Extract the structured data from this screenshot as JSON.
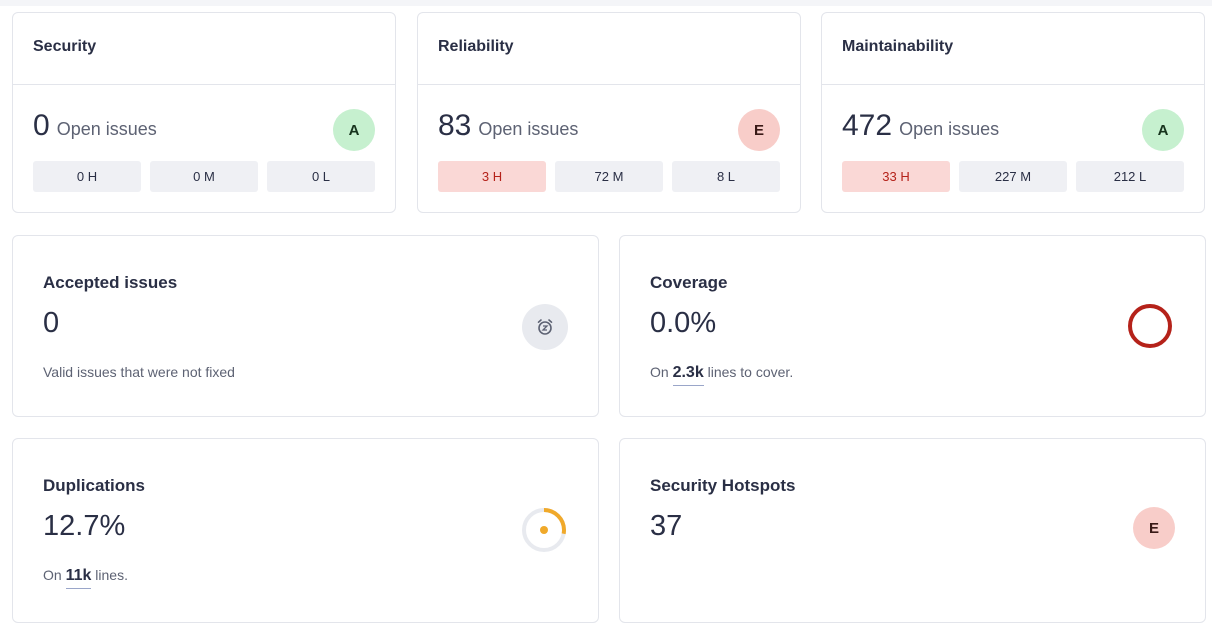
{
  "security": {
    "title": "Security",
    "count": "0",
    "open_label": "Open issues",
    "rating": "A",
    "severities": [
      "0 H",
      "0 M",
      "0 L"
    ]
  },
  "reliability": {
    "title": "Reliability",
    "count": "83",
    "open_label": "Open issues",
    "rating": "E",
    "severities": [
      "3 H",
      "72 M",
      "8 L"
    ]
  },
  "maintainability": {
    "title": "Maintainability",
    "count": "472",
    "open_label": "Open issues",
    "rating": "A",
    "severities": [
      "33 H",
      "227 M",
      "212 L"
    ]
  },
  "accepted": {
    "title": "Accepted issues",
    "value": "0",
    "description": "Valid issues that were not fixed",
    "icon": "clock-icon"
  },
  "coverage": {
    "title": "Coverage",
    "value": "0.0%",
    "prefix": "On",
    "lines": "2.3k",
    "suffix": "lines to cover.",
    "percent": 0,
    "ring_color": "#b5221a"
  },
  "duplications": {
    "title": "Duplications",
    "value": "12.7%",
    "prefix": "On",
    "lines": "11k",
    "suffix": "lines.",
    "percent": 12.7,
    "ring_color": "#f0a92a"
  },
  "hotspots": {
    "title": "Security Hotspots",
    "value": "37",
    "rating": "E"
  },
  "colors": {
    "rating_a_bg": "#c6f0cf",
    "rating_e_bg": "#f8cdc9",
    "high_bg": "#fad8d6",
    "high_text": "#b5221a"
  }
}
